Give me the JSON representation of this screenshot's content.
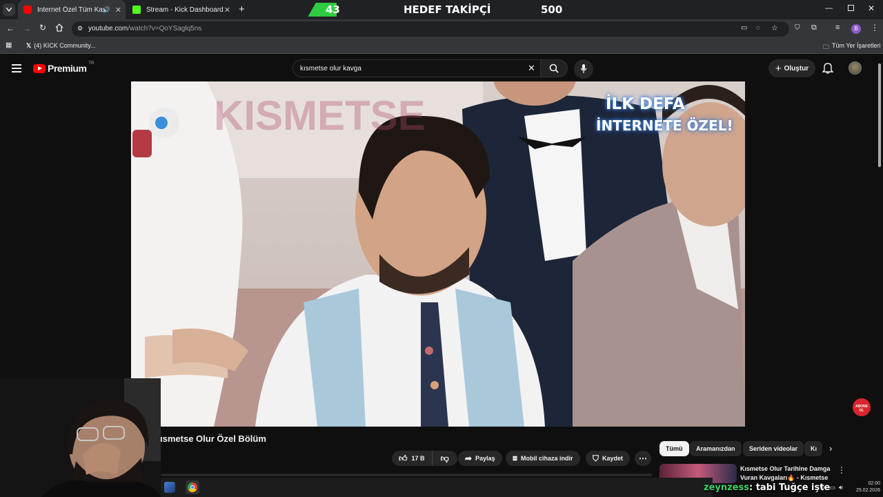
{
  "browser": {
    "tabs": [
      {
        "label": "İnternet Özel Tüm Kavgala",
        "active": true,
        "favicon_color": "#ff0000"
      },
      {
        "label": "Stream - Kick Dashboard",
        "active": false,
        "favicon_color": "#53fc18"
      }
    ],
    "url_host": "youtube.com",
    "url_path": "/watch?v=QoYSaglq5ns",
    "bookmarks": [
      {
        "label": "(4) KICK Community..."
      }
    ],
    "all_bookmarks_label": "Tüm Yer İşaretleri",
    "profile_letter": "B"
  },
  "stream_overlay": {
    "current": "43",
    "title": "HEDEF TAKİPÇİ",
    "goal": "500"
  },
  "youtube": {
    "logo_text": "Premium",
    "region": "TR",
    "search_value": "kısmetse olur kavga",
    "create_label": "Oluştur"
  },
  "video": {
    "watermark_line1": "İLK DEFA",
    "watermark_line2": "İNTERNETE ÖZEL!",
    "set_text": "KISMETSE",
    "subscribe_badge": "ABONE OL",
    "title": "ısmetse Olur Özel Bölüm"
  },
  "actions": {
    "likes": "17 B",
    "share": "Paylaş",
    "download": "Mobil cihaza indir",
    "save": "Kaydet"
  },
  "chips": [
    "Tümü",
    "Aramanızdan",
    "Seriden videolar",
    "Kı"
  ],
  "recommendation": {
    "title_line1": "Kısmetse Olur Tarihine Damga",
    "title_line2": "Vuran Kavgaları🔥 - Kısmetse"
  },
  "chat": {
    "user": "zeynzess",
    "message": ": tabi Tuğçe işte"
  },
  "system_tray": {
    "time": "02:00",
    "date": "25.02.2026"
  }
}
